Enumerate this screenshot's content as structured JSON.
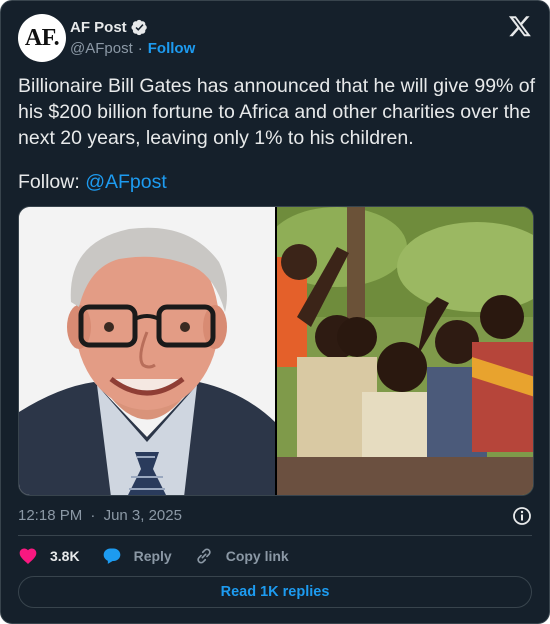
{
  "author": {
    "avatar_text": "AF.",
    "display_name": "AF Post",
    "handle": "@AFpost",
    "separator": "·",
    "follow_label": "Follow"
  },
  "tweet": {
    "text": "Billionaire Bill Gates has announced that he will give 99% of his $200 billion fortune to Africa and other charities over the next 20 years, leaving only 1% to his children.",
    "follow_prefix": "Follow: ",
    "follow_mention": "@AFpost"
  },
  "media": {
    "left_image": "bill-gates-smiling-photo",
    "right_image": "children-raising-hands-photo"
  },
  "meta": {
    "time": "12:18 PM",
    "separator": "·",
    "date": "Jun 3, 2025"
  },
  "actions": {
    "likes": "3.8K",
    "reply_label": "Reply",
    "copy_label": "Copy link"
  },
  "read_replies_label": "Read 1K replies",
  "colors": {
    "background": "#15202b",
    "accent": "#1d9bf0",
    "like": "#f91880",
    "muted": "#8b98a5",
    "text": "#e7e9ea"
  },
  "icons": [
    "verified-badge-icon",
    "x-logo-icon",
    "info-icon",
    "heart-icon",
    "reply-bubble-icon",
    "link-icon"
  ]
}
